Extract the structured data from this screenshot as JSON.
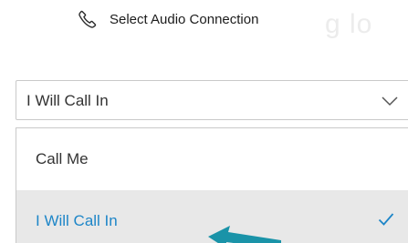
{
  "header": {
    "title": "Select Audio Connection",
    "icon": "phone-icon",
    "background_partial_text": "g lo"
  },
  "audio_select": {
    "value": "I Will Call In",
    "icon": "chevron-down-icon"
  },
  "dropdown": {
    "options": [
      {
        "label": "Call Me",
        "selected": false
      },
      {
        "label": "I Will Call In",
        "selected": true,
        "icon": "checkmark-icon"
      }
    ]
  },
  "colors": {
    "selected_text": "#1e86c8",
    "selected_bg": "#e8e8e8",
    "border": "#c9c9c9",
    "annotation_arrow": "#1a93a8"
  }
}
